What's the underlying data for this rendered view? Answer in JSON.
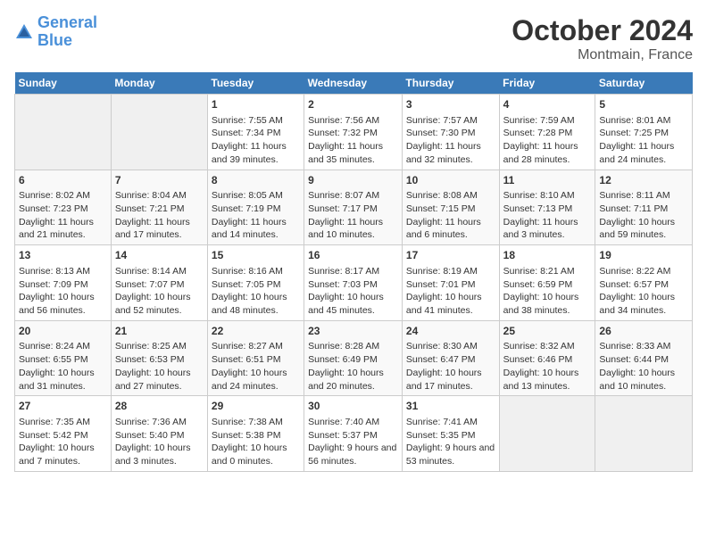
{
  "logo": {
    "line1": "General",
    "line2": "Blue"
  },
  "title": "October 2024",
  "location": "Montmain, France",
  "header": {
    "days": [
      "Sunday",
      "Monday",
      "Tuesday",
      "Wednesday",
      "Thursday",
      "Friday",
      "Saturday"
    ]
  },
  "weeks": [
    [
      {
        "num": "",
        "sunrise": "",
        "sunset": "",
        "daylight": ""
      },
      {
        "num": "",
        "sunrise": "",
        "sunset": "",
        "daylight": ""
      },
      {
        "num": "1",
        "sunrise": "Sunrise: 7:55 AM",
        "sunset": "Sunset: 7:34 PM",
        "daylight": "Daylight: 11 hours and 39 minutes."
      },
      {
        "num": "2",
        "sunrise": "Sunrise: 7:56 AM",
        "sunset": "Sunset: 7:32 PM",
        "daylight": "Daylight: 11 hours and 35 minutes."
      },
      {
        "num": "3",
        "sunrise": "Sunrise: 7:57 AM",
        "sunset": "Sunset: 7:30 PM",
        "daylight": "Daylight: 11 hours and 32 minutes."
      },
      {
        "num": "4",
        "sunrise": "Sunrise: 7:59 AM",
        "sunset": "Sunset: 7:28 PM",
        "daylight": "Daylight: 11 hours and 28 minutes."
      },
      {
        "num": "5",
        "sunrise": "Sunrise: 8:01 AM",
        "sunset": "Sunset: 7:25 PM",
        "daylight": "Daylight: 11 hours and 24 minutes."
      }
    ],
    [
      {
        "num": "6",
        "sunrise": "Sunrise: 8:02 AM",
        "sunset": "Sunset: 7:23 PM",
        "daylight": "Daylight: 11 hours and 21 minutes."
      },
      {
        "num": "7",
        "sunrise": "Sunrise: 8:04 AM",
        "sunset": "Sunset: 7:21 PM",
        "daylight": "Daylight: 11 hours and 17 minutes."
      },
      {
        "num": "8",
        "sunrise": "Sunrise: 8:05 AM",
        "sunset": "Sunset: 7:19 PM",
        "daylight": "Daylight: 11 hours and 14 minutes."
      },
      {
        "num": "9",
        "sunrise": "Sunrise: 8:07 AM",
        "sunset": "Sunset: 7:17 PM",
        "daylight": "Daylight: 11 hours and 10 minutes."
      },
      {
        "num": "10",
        "sunrise": "Sunrise: 8:08 AM",
        "sunset": "Sunset: 7:15 PM",
        "daylight": "Daylight: 11 hours and 6 minutes."
      },
      {
        "num": "11",
        "sunrise": "Sunrise: 8:10 AM",
        "sunset": "Sunset: 7:13 PM",
        "daylight": "Daylight: 11 hours and 3 minutes."
      },
      {
        "num": "12",
        "sunrise": "Sunrise: 8:11 AM",
        "sunset": "Sunset: 7:11 PM",
        "daylight": "Daylight: 10 hours and 59 minutes."
      }
    ],
    [
      {
        "num": "13",
        "sunrise": "Sunrise: 8:13 AM",
        "sunset": "Sunset: 7:09 PM",
        "daylight": "Daylight: 10 hours and 56 minutes."
      },
      {
        "num": "14",
        "sunrise": "Sunrise: 8:14 AM",
        "sunset": "Sunset: 7:07 PM",
        "daylight": "Daylight: 10 hours and 52 minutes."
      },
      {
        "num": "15",
        "sunrise": "Sunrise: 8:16 AM",
        "sunset": "Sunset: 7:05 PM",
        "daylight": "Daylight: 10 hours and 48 minutes."
      },
      {
        "num": "16",
        "sunrise": "Sunrise: 8:17 AM",
        "sunset": "Sunset: 7:03 PM",
        "daylight": "Daylight: 10 hours and 45 minutes."
      },
      {
        "num": "17",
        "sunrise": "Sunrise: 8:19 AM",
        "sunset": "Sunset: 7:01 PM",
        "daylight": "Daylight: 10 hours and 41 minutes."
      },
      {
        "num": "18",
        "sunrise": "Sunrise: 8:21 AM",
        "sunset": "Sunset: 6:59 PM",
        "daylight": "Daylight: 10 hours and 38 minutes."
      },
      {
        "num": "19",
        "sunrise": "Sunrise: 8:22 AM",
        "sunset": "Sunset: 6:57 PM",
        "daylight": "Daylight: 10 hours and 34 minutes."
      }
    ],
    [
      {
        "num": "20",
        "sunrise": "Sunrise: 8:24 AM",
        "sunset": "Sunset: 6:55 PM",
        "daylight": "Daylight: 10 hours and 31 minutes."
      },
      {
        "num": "21",
        "sunrise": "Sunrise: 8:25 AM",
        "sunset": "Sunset: 6:53 PM",
        "daylight": "Daylight: 10 hours and 27 minutes."
      },
      {
        "num": "22",
        "sunrise": "Sunrise: 8:27 AM",
        "sunset": "Sunset: 6:51 PM",
        "daylight": "Daylight: 10 hours and 24 minutes."
      },
      {
        "num": "23",
        "sunrise": "Sunrise: 8:28 AM",
        "sunset": "Sunset: 6:49 PM",
        "daylight": "Daylight: 10 hours and 20 minutes."
      },
      {
        "num": "24",
        "sunrise": "Sunrise: 8:30 AM",
        "sunset": "Sunset: 6:47 PM",
        "daylight": "Daylight: 10 hours and 17 minutes."
      },
      {
        "num": "25",
        "sunrise": "Sunrise: 8:32 AM",
        "sunset": "Sunset: 6:46 PM",
        "daylight": "Daylight: 10 hours and 13 minutes."
      },
      {
        "num": "26",
        "sunrise": "Sunrise: 8:33 AM",
        "sunset": "Sunset: 6:44 PM",
        "daylight": "Daylight: 10 hours and 10 minutes."
      }
    ],
    [
      {
        "num": "27",
        "sunrise": "Sunrise: 7:35 AM",
        "sunset": "Sunset: 5:42 PM",
        "daylight": "Daylight: 10 hours and 7 minutes."
      },
      {
        "num": "28",
        "sunrise": "Sunrise: 7:36 AM",
        "sunset": "Sunset: 5:40 PM",
        "daylight": "Daylight: 10 hours and 3 minutes."
      },
      {
        "num": "29",
        "sunrise": "Sunrise: 7:38 AM",
        "sunset": "Sunset: 5:38 PM",
        "daylight": "Daylight: 10 hours and 0 minutes."
      },
      {
        "num": "30",
        "sunrise": "Sunrise: 7:40 AM",
        "sunset": "Sunset: 5:37 PM",
        "daylight": "Daylight: 9 hours and 56 minutes."
      },
      {
        "num": "31",
        "sunrise": "Sunrise: 7:41 AM",
        "sunset": "Sunset: 5:35 PM",
        "daylight": "Daylight: 9 hours and 53 minutes."
      },
      {
        "num": "",
        "sunrise": "",
        "sunset": "",
        "daylight": ""
      },
      {
        "num": "",
        "sunrise": "",
        "sunset": "",
        "daylight": ""
      }
    ]
  ]
}
